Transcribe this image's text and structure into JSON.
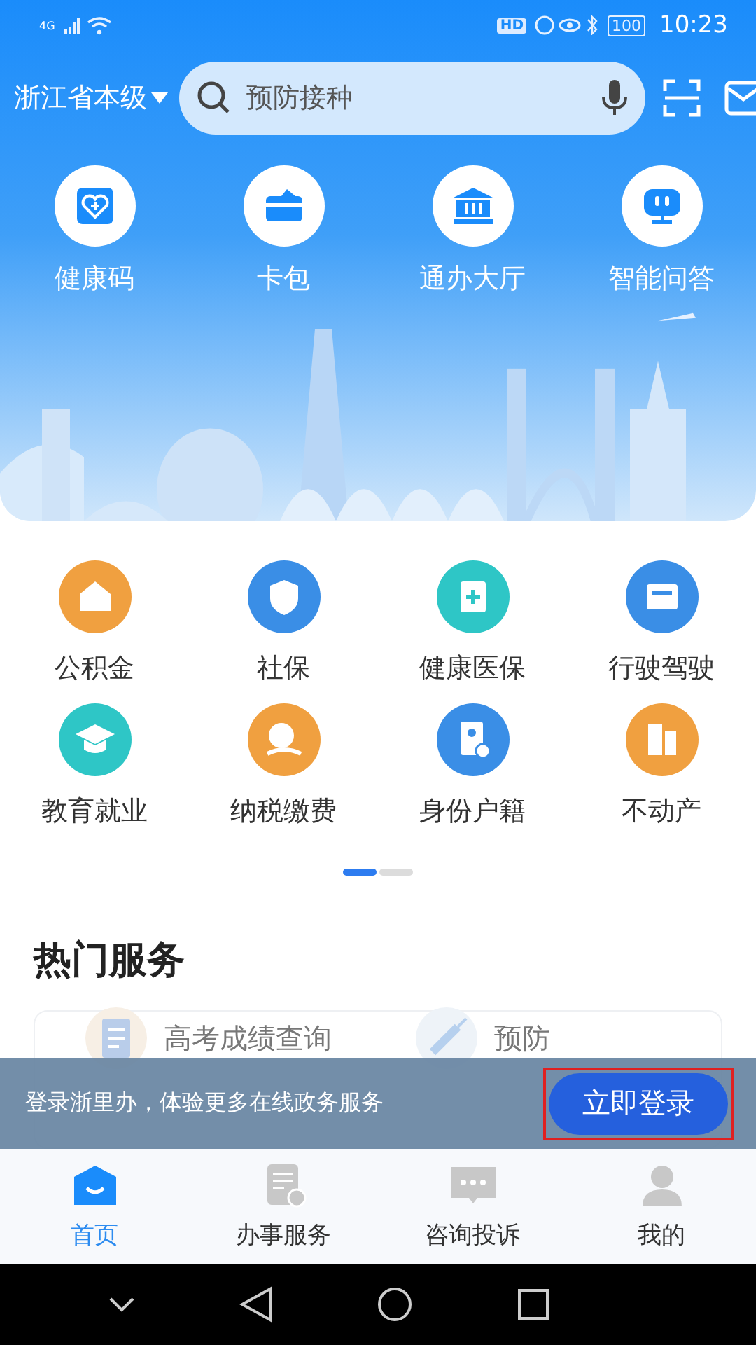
{
  "status_bar": {
    "network": "4G",
    "battery": "100",
    "time": "10:23",
    "hd": "HD"
  },
  "header": {
    "region": "浙江省本级",
    "search": {
      "placeholder": "预防接种"
    }
  },
  "quick_actions": [
    {
      "label": "健康码",
      "kind": "heart"
    },
    {
      "label": "卡包",
      "kind": "card"
    },
    {
      "label": "通办大厅",
      "kind": "hall"
    },
    {
      "label": "智能问答",
      "kind": "robot"
    }
  ],
  "services": [
    {
      "label": "公积金",
      "kind": "house",
      "color": "#f0a040"
    },
    {
      "label": "社保",
      "kind": "shield",
      "color": "#3a8ee6"
    },
    {
      "label": "健康医保",
      "kind": "clipboard",
      "color": "#2ec6c6"
    },
    {
      "label": "行驶驾驶",
      "kind": "license",
      "color": "#3a8ee6"
    },
    {
      "label": "教育就业",
      "kind": "cap",
      "color": "#2ec6c6"
    },
    {
      "label": "纳税缴费",
      "kind": "coin",
      "color": "#f0a040"
    },
    {
      "label": "身份户籍",
      "kind": "id",
      "color": "#3a8ee6"
    },
    {
      "label": "不动产",
      "kind": "building",
      "color": "#f0a040"
    }
  ],
  "pager": [
    {
      "selected": true
    },
    {
      "selected": false
    }
  ],
  "hot_services": {
    "title": "热门服务",
    "items": [
      {
        "label": "高考成绩查询",
        "kind": "exam"
      },
      {
        "label": "预防",
        "kind": "vaccine"
      }
    ]
  },
  "login_banner": {
    "text": "登录浙里办，体验更多在线政务服务",
    "button": "立即登录",
    "highlighted": true
  },
  "tabs": [
    {
      "label": "首页",
      "kind": "home",
      "selected": true
    },
    {
      "label": "办事服务",
      "kind": "doc",
      "selected": false
    },
    {
      "label": "咨询投诉",
      "kind": "chat",
      "selected": false
    },
    {
      "label": "我的",
      "kind": "user",
      "selected": false
    }
  ]
}
